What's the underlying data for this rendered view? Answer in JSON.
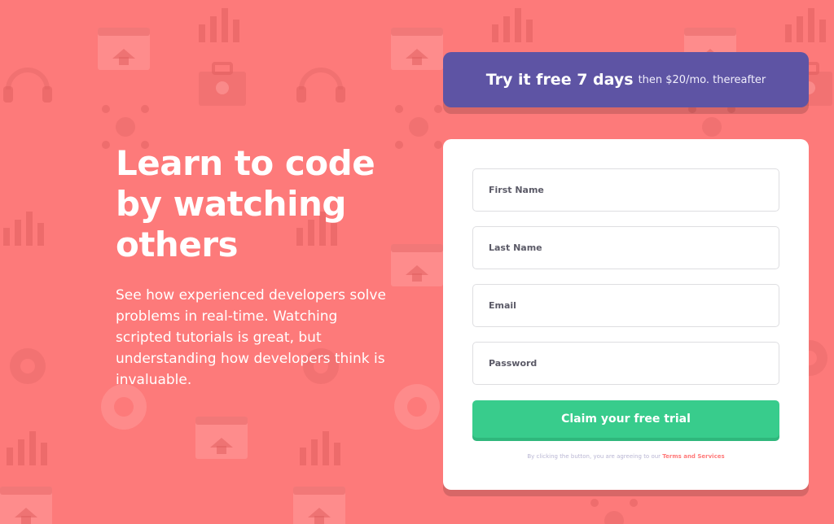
{
  "theme": {
    "background": "#fd7a7a",
    "promo_bg": "#5e54a4",
    "button": "#38cc8c",
    "link": "#ff7a7a"
  },
  "hero": {
    "title": "Learn to code by watching others",
    "text": "See how experienced developers solve problems in real-time. Watching scripted tutorials is great, but understanding how developers think is invaluable."
  },
  "promo": {
    "strong": "Try it free 7 days",
    "rest": "then $20/mo. thereafter"
  },
  "form": {
    "first_name_placeholder": "First Name",
    "last_name_placeholder": "Last Name",
    "email_placeholder": "Email",
    "password_placeholder": "Password",
    "submit_label": "Claim your free trial",
    "terms_prefix": "By clicking the button, you are agreeing to our",
    "terms_link": "Terms and Services"
  },
  "background_icons": [
    "code-window-icon",
    "headset-icon",
    "toolbox-icon",
    "network-icon",
    "bar-chart-icon",
    "rocket-icon",
    "gear-icon",
    "lifebuoy-icon",
    "lightbulb-icon",
    "calendar-icon",
    "magnet-icon",
    "globe-icon"
  ]
}
